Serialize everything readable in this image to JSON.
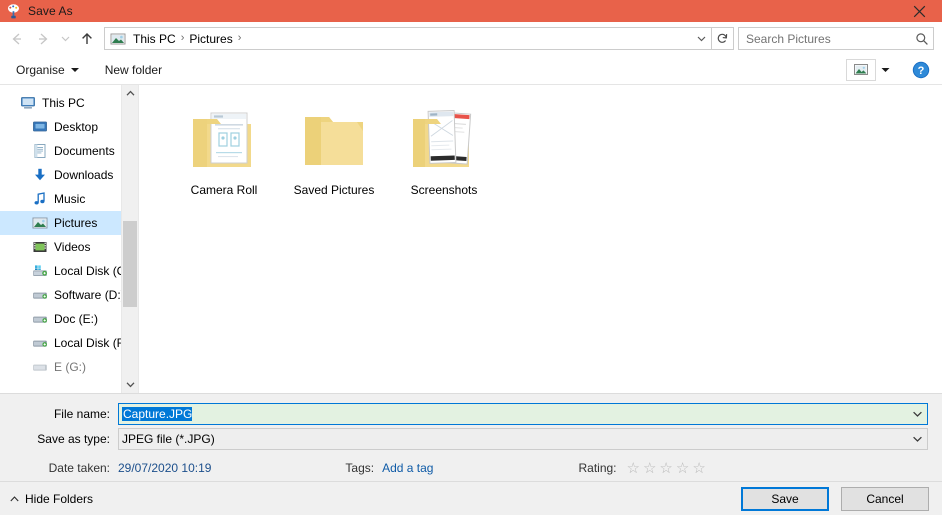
{
  "window": {
    "title": "Save As",
    "app_icon": "paint-icon",
    "close_label": "✕",
    "titlebar_color": "#e8624a"
  },
  "nav": {
    "back_icon": "arrow-left-icon",
    "forward_icon": "arrow-right-icon",
    "recent_icon": "chevron-down-icon",
    "up_icon": "arrow-up-icon",
    "breadcrumb_icon": "pictures-icon",
    "crumbs": [
      "This PC",
      "Pictures"
    ],
    "separator": "›",
    "dropdown_icon": "chevron-down-icon",
    "refresh_icon": "refresh-icon"
  },
  "search": {
    "placeholder": "Search Pictures",
    "icon": "search-icon"
  },
  "toolbar": {
    "organise_label": "Organise",
    "organise_caret": "caret-down-icon",
    "new_folder_label": "New folder",
    "view_icon": "view-layout-icon",
    "view_caret": "caret-down-icon",
    "help_icon": "help-icon",
    "help_glyph": "?"
  },
  "sidebar": {
    "scroll_up_icon": "chevron-up-icon",
    "scroll_down_icon": "chevron-down-icon",
    "items": [
      {
        "label": "This PC",
        "icon": "this-pc-icon",
        "level": 1,
        "selected": false
      },
      {
        "label": "Desktop",
        "icon": "desktop-icon",
        "level": 2,
        "selected": false
      },
      {
        "label": "Documents",
        "icon": "documents-icon",
        "level": 2,
        "selected": false
      },
      {
        "label": "Downloads",
        "icon": "downloads-icon",
        "level": 2,
        "selected": false
      },
      {
        "label": "Music",
        "icon": "music-icon",
        "level": 2,
        "selected": false
      },
      {
        "label": "Pictures",
        "icon": "pictures-icon",
        "level": 2,
        "selected": true
      },
      {
        "label": "Videos",
        "icon": "videos-icon",
        "level": 2,
        "selected": false
      },
      {
        "label": "Local Disk (C:)",
        "icon": "system-drive-icon",
        "level": 2,
        "selected": false
      },
      {
        "label": "Software (D:)",
        "icon": "drive-icon",
        "level": 2,
        "selected": false
      },
      {
        "label": "Doc (E:)",
        "icon": "drive-icon",
        "level": 2,
        "selected": false
      },
      {
        "label": "Local Disk (F:)",
        "icon": "drive-icon",
        "level": 2,
        "selected": false
      },
      {
        "label": "E (G:)",
        "icon": "drive-icon",
        "level": 2,
        "selected": false
      }
    ]
  },
  "content": {
    "items": [
      {
        "name": "Camera Roll",
        "thumb": "folder-with-document"
      },
      {
        "name": "Saved Pictures",
        "thumb": "folder-empty"
      },
      {
        "name": "Screenshots",
        "thumb": "folder-with-pages"
      }
    ]
  },
  "fields": {
    "filename_label": "File name:",
    "filename_value": "Capture.JPG",
    "filename_caret": "chevron-down-icon",
    "filetype_label": "Save as type:",
    "filetype_value": "JPEG file (*.JPG)",
    "filetype_caret": "chevron-down-icon"
  },
  "metadata": {
    "date_taken_label": "Date taken:",
    "date_taken_value": "29/07/2020 10:19",
    "tags_label": "Tags:",
    "tags_value": "Add a tag",
    "rating_label": "Rating:",
    "rating_stars_total": 5,
    "rating_stars_filled": 0,
    "star_glyph": "☆"
  },
  "footer": {
    "hide_folders_label": "Hide Folders",
    "hide_folders_caret": "caret-up-icon",
    "save_label": "Save",
    "cancel_label": "Cancel",
    "accent_color": "#0078d7"
  }
}
